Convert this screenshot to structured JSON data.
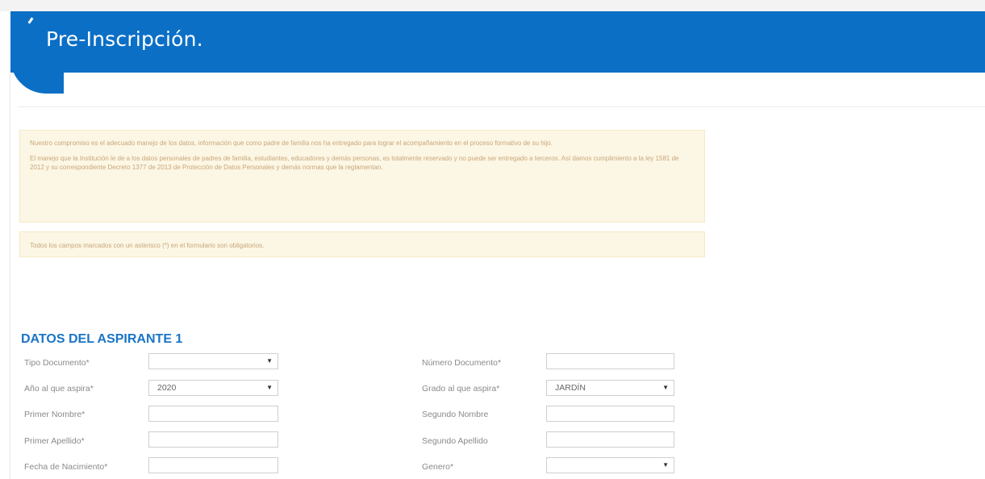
{
  "header": {
    "title": "Pre-Inscripción."
  },
  "notices": {
    "p1": "Nuestro compromiso es el adecuado manejo de los datos, información que como padre de familia nos ha entregado para lograr el acompañamiento en el proceso formativo de su hijo.",
    "p2": "El manejo que la Institución le de a los datos personales de padres de familia, estudiantes, educadores y demás personas, es totalmente reservado y no puede ser entregado a terceros. Así damos cumplimiento a la ley 1581 de 2012 y su correspondiente Decreto 1377 de 2013 de Protección de Datos Personales y demás normas que la reglamentan.",
    "p3": "Todos los campos marcados con un asterisco (*) en el formulario son obligatorios."
  },
  "section": {
    "title": "DATOS DEL ASPIRANTE 1"
  },
  "form": {
    "tipo_documento": {
      "label": "Tipo Documento*",
      "value": ""
    },
    "numero_documento": {
      "label": "Número Documento*",
      "value": ""
    },
    "anio": {
      "label": "Año al que aspira*",
      "value": "2020"
    },
    "grado": {
      "label": "Grado al que aspira*",
      "value": "JARDÍN"
    },
    "primer_nombre": {
      "label": "Primer Nombre*",
      "value": ""
    },
    "segundo_nombre": {
      "label": "Segundo Nombre",
      "value": ""
    },
    "primer_apellido": {
      "label": "Primer Apellido*",
      "value": ""
    },
    "segundo_apellido": {
      "label": "Segundo Apellido",
      "value": ""
    },
    "fecha_nacimiento": {
      "label": "Fecha de Nacimiento*",
      "value": ""
    },
    "genero": {
      "label": "Genero*",
      "value": ""
    }
  },
  "icons": {
    "dropdown": "chevron-down-icon"
  },
  "colors": {
    "banner": "#0b6fc6",
    "section_title": "#1a75c7",
    "notice_bg": "#fcf6e4",
    "notice_text": "#c9a77a"
  }
}
